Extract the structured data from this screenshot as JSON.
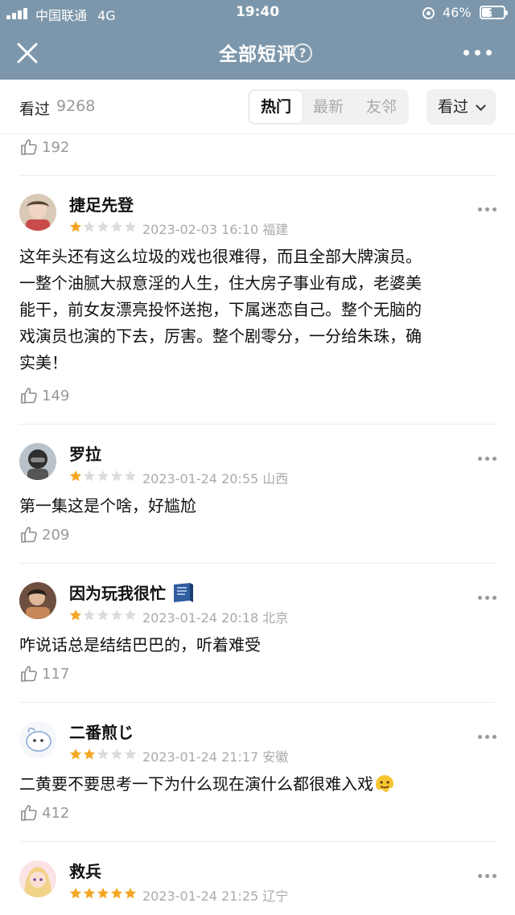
{
  "status_bar": {
    "carrier": "中国联通",
    "network": "4G",
    "time": "19:40",
    "battery": "46%",
    "battery_level": 0.46
  },
  "header": {
    "title": "全部短评",
    "help_icon": "question-circle-icon",
    "close_icon": "close-icon",
    "more_icon": "more-dots-icon"
  },
  "filter_bar": {
    "seen_label": "看过",
    "seen_count": "9268",
    "tabs": [
      "热门",
      "最新",
      "友邻"
    ],
    "active_tab": "热门",
    "sort_label": "看过"
  },
  "prev_review": {
    "likes": "192"
  },
  "reviews": [
    {
      "user": "捷足先登",
      "rating": 1,
      "date": "2023-02-03 16:10",
      "location": "福建",
      "lines": [
        "这年头还有这么垃圾的戏也很难得，而且全部大牌演员。",
        "一整个油腻大叔意淫的人生，住大房子事业有成，老婆美",
        "能干，前女友漂亮投怀送抱，下属迷恋自己。整个无脑的",
        "戏演员也演的下去，厉害。整个剧零分，一分给朱珠，确",
        "实美！"
      ],
      "likes": "149"
    },
    {
      "user": "罗拉",
      "rating": 1,
      "date": "2023-01-24 20:55",
      "location": "山西",
      "lines": [
        "第一集这是个啥，好尴尬"
      ],
      "likes": "209"
    },
    {
      "user": "因为玩我很忙",
      "badge": "book-icon",
      "rating": 1,
      "date": "2023-01-24 20:18",
      "location": "北京",
      "lines": [
        "咋说话总是结结巴巴的，听着难受"
      ],
      "likes": "117"
    },
    {
      "user": "二番煎じ",
      "rating": 2,
      "date": "2023-01-24 21:17",
      "location": "安徽",
      "lines": [
        "二黄要不要思考一下为什么现在演什么都很难入戏"
      ],
      "emoji": "melting-face-icon",
      "likes": "412"
    },
    {
      "user": "救兵",
      "rating": 5,
      "date": "2023-01-24 21:25",
      "location": "辽宁",
      "lines": [],
      "likes": ""
    }
  ],
  "colors": {
    "header_bg": "#7c97ab",
    "star_on": "#f5a623",
    "star_off": "#dcdcdc",
    "muted": "#999999"
  }
}
